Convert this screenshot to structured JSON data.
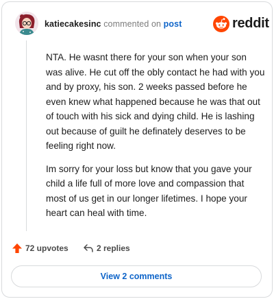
{
  "comment": {
    "username": "katiecakesinc",
    "action_text": "commented on",
    "post_link_text": "post",
    "paragraphs": [
      "NTA. He wasnt there for your son when your son was alive. He cut off the obly contact he had with you and by proxy, his son. 2 weeks passed before he even knew what happened because he was that out of touch with his sick and dying child. He is lashing out because of guilt he definately deserves to be feeling right now.",
      "Im sorry for your loss but know that you gave your child a life full of more love and compassion that most of us get in our longer lifetimes. I hope your heart can heal with time."
    ]
  },
  "brand": {
    "wordmark": "reddit",
    "color": "#ff4500"
  },
  "actions": {
    "upvotes_label": "72 upvotes",
    "replies_label": "2 replies",
    "upvote_icon": "upvote-arrow-icon",
    "reply_icon": "reply-arrow-icon"
  },
  "footer": {
    "view_comments_label": "View 2 comments"
  },
  "colors": {
    "accent": "#ff4500",
    "link": "#0f65c9",
    "text": "#1c1c1c",
    "muted": "#7c7c7c",
    "border": "#d8dadc"
  }
}
